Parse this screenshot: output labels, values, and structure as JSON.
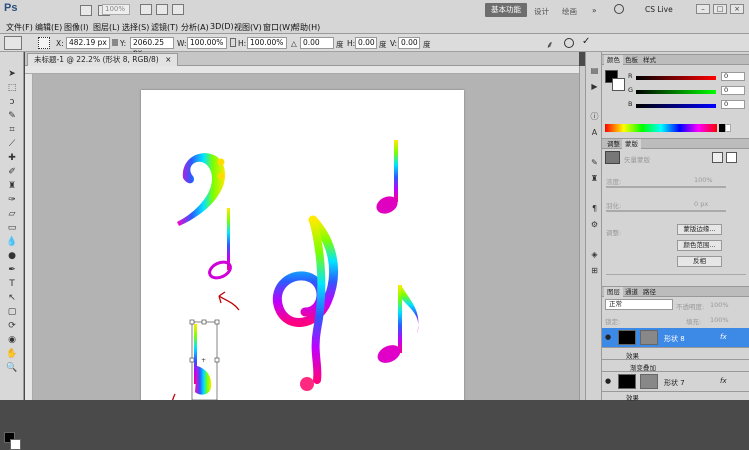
{
  "app": {
    "logo": "Ps"
  },
  "menu": [
    "文件(F)",
    "编辑(E)",
    "图像(I)",
    "图层(L)",
    "选择(S)",
    "滤镜(T)",
    "分析(A)",
    "3D(D)",
    "视图(V)",
    "窗口(W)",
    "帮助(H)"
  ],
  "topbar": {
    "zoom": "100%",
    "workspace_active": "基本功能",
    "workspace_other": [
      "设计",
      "绘画"
    ],
    "cslive": "CS Live"
  },
  "options": {
    "x_label": "X:",
    "x_value": "482.19 px",
    "y_label": "Y:",
    "y_value": "2060.25 px",
    "w_label": "W:",
    "w_value": "100.00%",
    "h_label": "H:",
    "h_value": "100.00%",
    "angle_value": "0.00",
    "angle_unit": "度",
    "hskew_label": "H:",
    "hskew_value": "0.00",
    "hskew_unit": "度",
    "vskew_label": "V:",
    "vskew_value": "0.00",
    "vskew_unit": "度"
  },
  "document": {
    "tab_title": "未标题-1 @ 22.2% (形状 8, RGB/8)",
    "tab_close": "×"
  },
  "color_panel": {
    "tabs": [
      "颜色",
      "色板",
      "样式"
    ],
    "r_value": "0",
    "g_value": "0",
    "b_value": "0",
    "r_label": "R",
    "g_label": "G",
    "b_label": "B"
  },
  "masks_panel": {
    "tabs": [
      "调整",
      "蒙版"
    ],
    "heading": "矢量蒙版",
    "density_label": "浓度:",
    "density_value": "100%",
    "feather_label": "羽化:",
    "feather_value": "0 px",
    "refine_label": "调整:",
    "btn_mask_edge": "蒙版边缘...",
    "btn_color_range": "颜色范围...",
    "btn_invert": "反相"
  },
  "layers_panel": {
    "tabs": [
      "图层",
      "通道",
      "路径"
    ],
    "blend_mode": "正常",
    "opacity_label": "不透明度:",
    "opacity_value": "100%",
    "lock_label": "锁定:",
    "fill_label": "填充:",
    "fill_value": "100%",
    "layers": [
      {
        "name": "形状 8",
        "fx": "fx",
        "selected": true
      },
      {
        "name": "效果",
        "sub": true
      },
      {
        "name": "渐变叠加",
        "sub": true
      },
      {
        "name": "形状 7",
        "fx": "fx",
        "selected": false
      },
      {
        "name": "效果",
        "sub": true
      }
    ]
  },
  "colors": {
    "accent": "#3c6ec8",
    "selected_layer": "#3d89e6"
  }
}
